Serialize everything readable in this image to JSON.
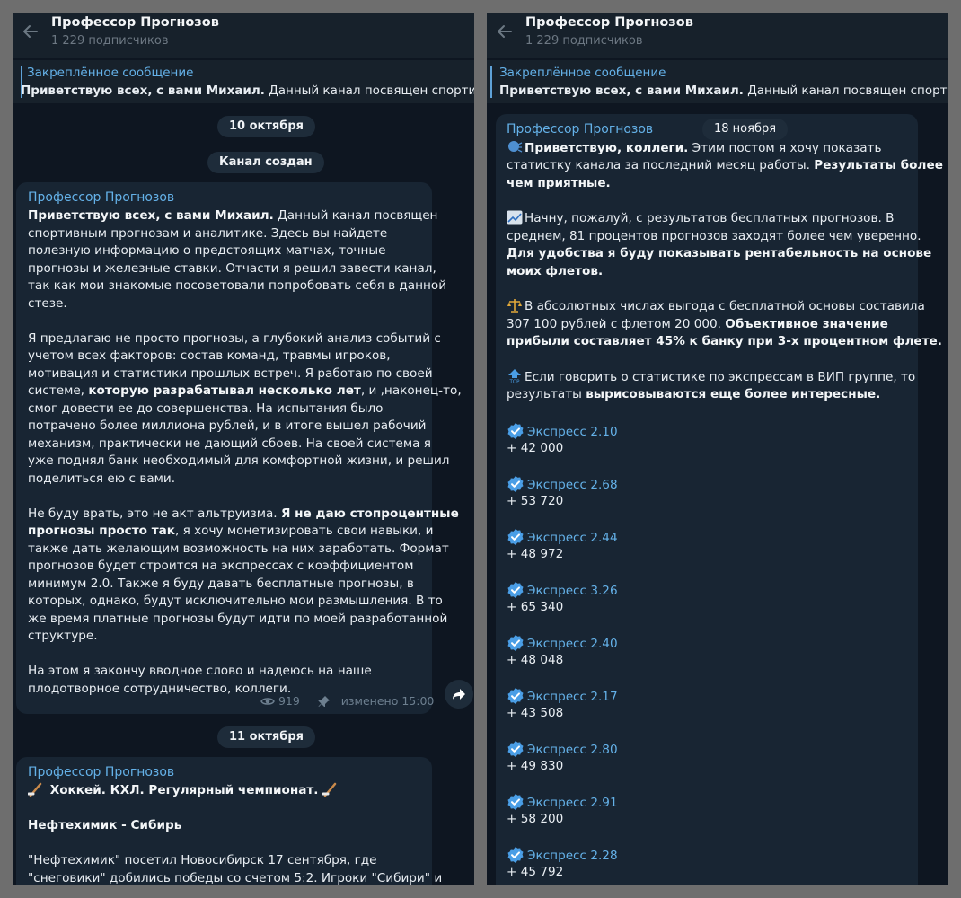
{
  "left": {
    "channel_title": "Профессор Прогнозов",
    "subscribers": "1 229 подписчиков",
    "pinned_label": "Закреплённое сообщение",
    "pinned_bold": "Приветствую всех, с вами Михаил.",
    "pinned_rest": " Данный канал посвящен спортивным прогнозам и аналитике.",
    "date1": "10 октября",
    "service": "Канал создан",
    "post1": {
      "author": "Профессор Прогнозов",
      "l1_bold": "Приветствую всех, с вами Михаил.",
      "l1_rest": " Данный канал посвящен",
      "l2": "спортивным прогнозам и аналитике. Здесь вы найдете",
      "l3": "полезную информацию о предстоящих матчах, точные",
      "l4": "прогнозы и железные ставки. Отчасти я решил завести канал,",
      "l5": "так как мои знакомые посоветовали попробовать себя в данной",
      "l6": "стезе.",
      "l7": "Я предлагаю не просто прогнозы, а глубокий анализ событий с",
      "l8": "учетом всех факторов: состав команд, травмы игроков,",
      "l9": "мотивация и статистики прошлых встреч. Я работаю по своей",
      "l10_a": "системе, ",
      "l10_bold": "которую разрабатывал несколько лет",
      "l10_b": ", и ,наконец-то,",
      "l11": "смог довести ее до совершенства. На испытания было",
      "l12": "потрачено более миллиона рублей, и в итоге вышел рабочий",
      "l13": "механизм, практически не дающий сбоев. На своей система я",
      "l14": "уже поднял банк необходимый для комфортной жизни, и решил",
      "l15": "поделиться ею с вами.",
      "l16_a": "Не буду врать, это не акт альтруизма. ",
      "l16_bold": "Я не даю стопроцентные",
      "l17_bold": "прогнозы просто так",
      "l17_b": ", я хочу монетизировать свои навыки, и",
      "l18": "также дать желающим возможность на них заработать. Формат",
      "l19": "прогнозов будет строится на экспрессах с коэффициентом",
      "l20": "минимум 2.0. Также я буду давать бесплатные прогнозы, в",
      "l21": "которых, однако, будут исключительно мои размышления. В то",
      "l22": "же время платные прогнозы будут идти по моей разработанной",
      "l23": "структуре.",
      "l24": "На этом я закончу вводное слово и надеюсь на наше",
      "l25": "плодотворное сотрудничество, коллеги.",
      "views": "919",
      "edited": "изменено 15:00"
    },
    "date2": "11 октября",
    "post2": {
      "author": "Профессор Прогнозов",
      "headline": " Хоккей. КХЛ. Регулярный чемпионат. ",
      "match": "Нефтехимик - Сибирь",
      "p1": "\"Нефтехимик\" посетил Новосибирск 17 сентября, где",
      "p2": "\"снеговики\" добились победы со счетом 5:2. Игроки \"Сибири\" и"
    }
  },
  "right": {
    "channel_title": "Профессор Прогнозов",
    "subscribers": "1 229 подписчиков",
    "pinned_label": "Закреплённое сообщение",
    "pinned_bold": "Приветствую всех, с вами Михаил.",
    "pinned_rest": " Данный канал посвящен спортивным прогнозам",
    "date": "18 ноября",
    "post": {
      "author": "Профессор Прогнозов",
      "l1_bold": "Приветствую, коллеги.",
      "l1_rest": " Этим постом я хочу показать",
      "l2_a": "статистку канала за последний месяц работы. ",
      "l2_bold": "Результаты более",
      "l3_bold": "чем приятные.",
      "l4": "Начну, пожалуй, с результатов бесплатных прогнозов. В",
      "l5": "среднем, 81 процентов прогнозов заходят более чем уверенно.",
      "l6_bold": "Для удобства я буду показывать рентабельность на основе",
      "l7_bold": "моих флетов.",
      "l8": "В абсолютных числах выгода с бесплатной основы составила",
      "l9_a": "307 100 рублей с флетом 20 000. ",
      "l9_bold": "Объективное значение",
      "l10_bold": "прибыли составляет 45% к банку при 3-х процентном флете.",
      "l11": "Если говорить о статистике по экспрессам в ВИП группе, то",
      "l12_a": "результаты ",
      "l12_bold": "вырисовываются еще более интересные.",
      "express": [
        {
          "label": "Экспресс 2.10",
          "profit": "+ 42 000"
        },
        {
          "label": "Экспресс 2.68",
          "profit": "+ 53 720"
        },
        {
          "label": "Экспресс 2.44",
          "profit": "+ 48 972"
        },
        {
          "label": "Экспресс 3.26",
          "profit": "+ 65 340"
        },
        {
          "label": "Экспресс 2.40",
          "profit": "+ 48 048"
        },
        {
          "label": "Экспресс 2.17",
          "profit": "+ 43 508"
        },
        {
          "label": "Экспресс 2.80",
          "profit": "+ 49 830"
        },
        {
          "label": "Экспресс 2.91",
          "profit": "+ 58 200"
        },
        {
          "label": "Экспресс 2.28",
          "profit": "+ 45 792"
        }
      ]
    }
  },
  "colors": {
    "background": "#0e1621",
    "header": "#17212b",
    "bubble": "#182533",
    "accent": "#64b1e8",
    "meta": "#6d7f8f"
  }
}
